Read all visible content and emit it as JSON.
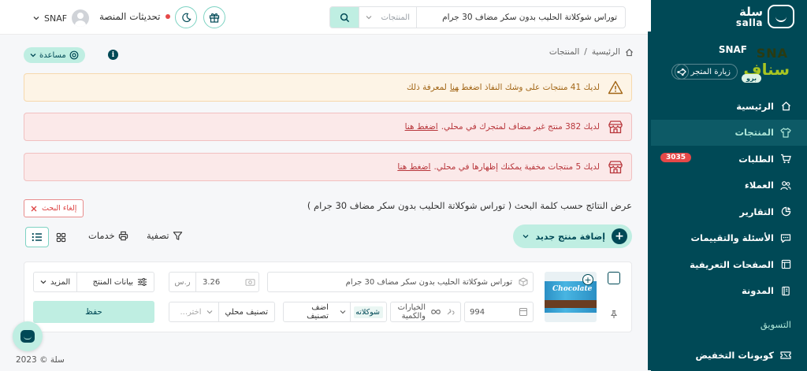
{
  "topbar": {
    "user_name": "SNAF",
    "updates_label": "تحديثات المنصة",
    "search_value": "توراس شوكلاتة الحليب بدون سكر مضاف 30 جرام",
    "search_scope": "المنتجات"
  },
  "breadcrumb": {
    "home": "الرئيسية",
    "separator": "/",
    "current": "المنتجات"
  },
  "help": {
    "label": "مساعدة"
  },
  "alerts": [
    {
      "text": "لديك 41 منتجات على وشك النفاذ اضغط",
      "link": "هنا",
      "suffix": "لمعرفة ذلك"
    },
    {
      "text": "لديك 382 منتج غير مضاف لمتجرك في محلي.",
      "link": "اضغط هنا",
      "suffix": ""
    },
    {
      "text": "لديك 5 منتجات مخفية يمكنك إظهارها في محلي.",
      "link": "اضغط هنا",
      "suffix": ""
    }
  ],
  "results": {
    "title": "عرض النتائج حسب كلمة البحث ( توراس شوكلاتة الحليب بدون سكر مضاف 30 جرام )",
    "cancel_label": "إلغاء البحث"
  },
  "toolbar": {
    "add_product": "إضافة منتج جديد",
    "filter": "تصفية",
    "services": "خدمات"
  },
  "product": {
    "name": "توراس شوكلاتة الحليب بدون سكر مضاف 30 جرام",
    "image_label": "Chocolate",
    "price": "3.26",
    "currency": "ر.س",
    "product_data": "بيانات المنتج",
    "more": "المزيد",
    "quantity": "994",
    "options": "الخيارات والكمية",
    "category_chip": "شوكلاته",
    "add_category": "اضف تصنيف",
    "local_category": "تصنيف محلي",
    "local_placeholder": "اختر...",
    "save": "حفظ"
  },
  "sidebar": {
    "logo_ar": "سلة",
    "logo_en": "salla",
    "store_name": "SNAF",
    "store_logo_top": "SNA",
    "store_logo_bottom": "سناف",
    "pro_badge": "برو",
    "visit_store": "زيارة المتجر",
    "items": [
      {
        "label": "الرئيسية",
        "icon": "home-icon"
      },
      {
        "label": "المنتجات",
        "icon": "shirt-icon",
        "active": true
      },
      {
        "label": "الطلبات",
        "icon": "cart-icon",
        "badge": "3035"
      },
      {
        "label": "العملاء",
        "icon": "users-icon"
      },
      {
        "label": "التقارير",
        "icon": "chart-icon"
      },
      {
        "label": "الأسئلة والتقييمات",
        "icon": "chat-icon"
      },
      {
        "label": "الصفحات التعريفية",
        "icon": "page-icon"
      },
      {
        "label": "المدونة",
        "icon": "book-icon"
      }
    ],
    "section_label": "التسويق",
    "coupons": "كوبونات التخفيض"
  },
  "footer": {
    "copyright": "سلة © 2023"
  },
  "colors": {
    "sidebar_bg": "#004956",
    "accent": "#bfeee2",
    "warning_bg": "#fdf4e6",
    "danger_bg": "#fbe9e9",
    "badge_red": "#e54848"
  }
}
